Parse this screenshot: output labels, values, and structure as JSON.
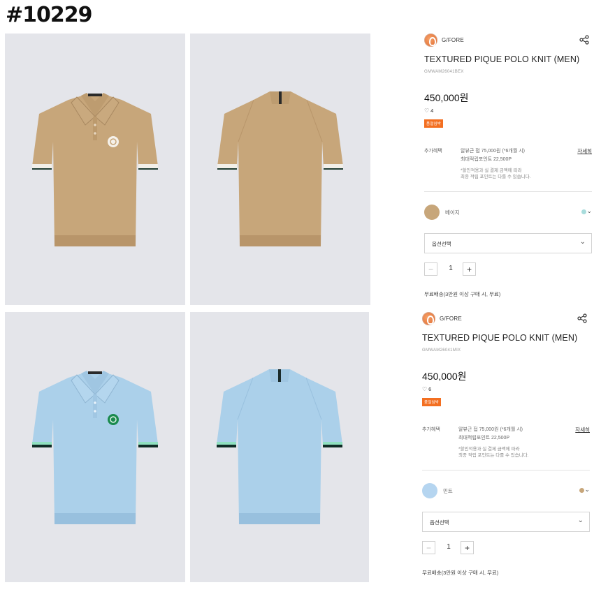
{
  "header": {
    "id_label": "#10229"
  },
  "photos": [
    {
      "alt": "front-beige"
    },
    {
      "alt": "back-beige"
    },
    {
      "alt": "front-mint"
    },
    {
      "alt": "back-mint"
    }
  ],
  "colors": {
    "beige": "#c7a67a",
    "beige_dark": "#b8956a",
    "mint": "#abd0ea",
    "mint_dark": "#98c0de",
    "badge_orange": "#f36f21",
    "logo_green": "#1a8a4e"
  },
  "products": [
    {
      "brand": "G/FORE",
      "name": "TEXTURED PIQUE POLO KNIT (MEN)",
      "code": "GMWAM26041BEX",
      "price": "450,000원",
      "likes": "4",
      "badge": "품절임박",
      "benefit_label": "추가혜택",
      "benefit_line1": "알뷰근 접 75,000원 (*6개월 시)",
      "benefit_line2": "최대적립포인트 22,500P",
      "benefit_note1": "*할인적용과 실 결제 금액에 따라",
      "benefit_note2": "최종 적립 포인트는 다를 수 있습니다.",
      "detail_link": "자세히",
      "color_name": "베이지",
      "swatch_color": "#c7a67a",
      "alt_color": "#a8dcdc",
      "option_placeholder": "옵션선택",
      "quantity": "1",
      "shipping": "무료배송(3만원 이상 구매 시, 무료)"
    },
    {
      "brand": "G/FORE",
      "name": "TEXTURED PIQUE POLO KNIT (MEN)",
      "code": "GMWAM26041MIX",
      "price": "450,000원",
      "likes": "6",
      "badge": "품절임박",
      "benefit_label": "추가혜택",
      "benefit_line1": "알뷰근 접 75,000원 (*6개월 시)",
      "benefit_line2": "최대적립포인트 22,500P",
      "benefit_note1": "*할인적용과 실 결제 금액에 따라",
      "benefit_note2": "최종 적립 포인트는 다를 수 있습니다.",
      "detail_link": "자세히",
      "color_name": "민트",
      "swatch_color": "#b5d5f0",
      "alt_color": "#c7a67a",
      "option_placeholder": "옵션선택",
      "quantity": "1",
      "shipping": "무료배송(3만원 이상 구매 시, 무료)"
    }
  ]
}
